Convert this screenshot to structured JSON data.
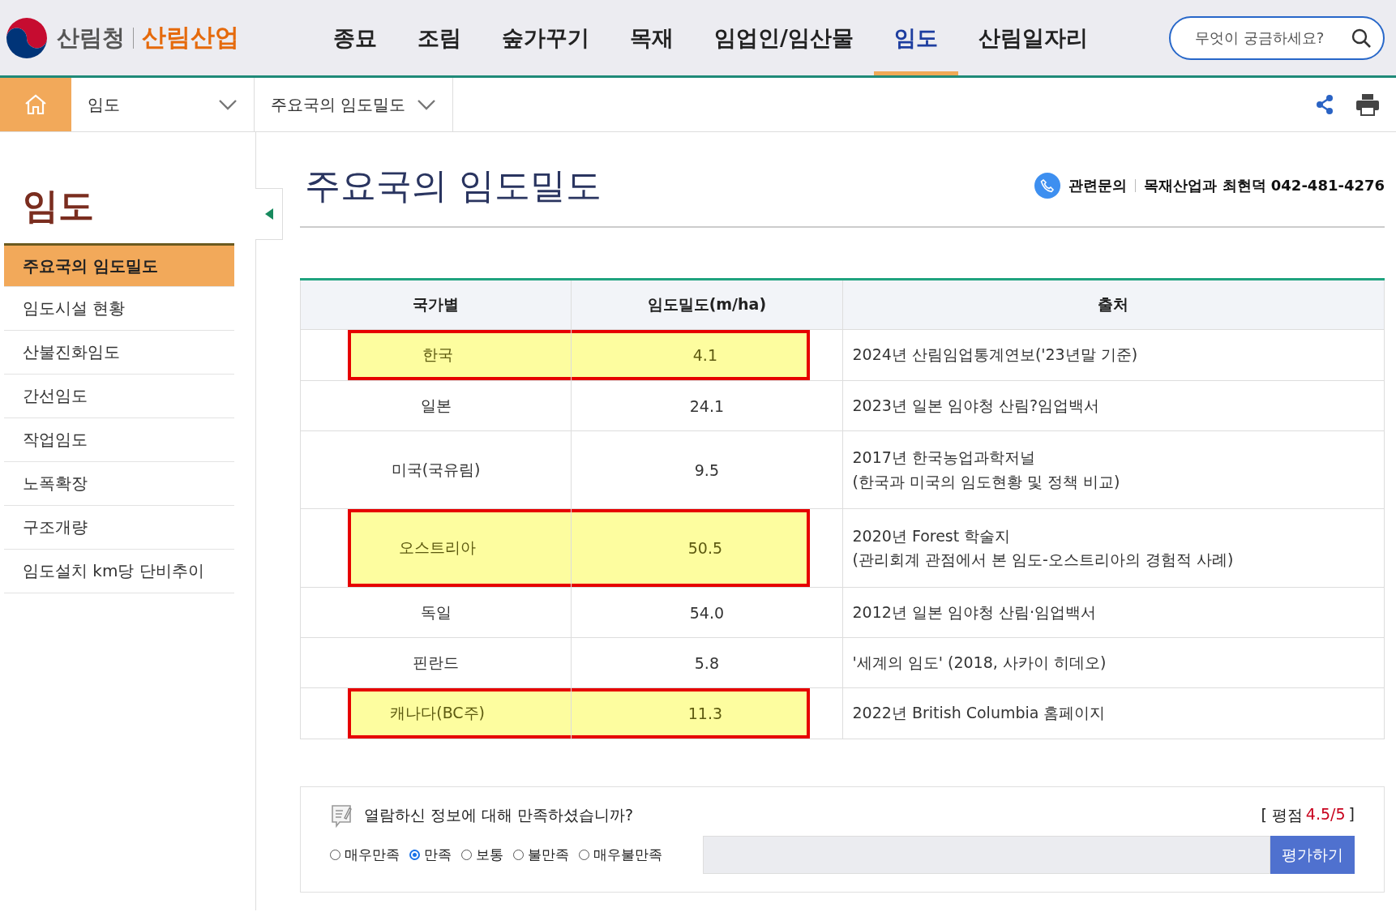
{
  "header": {
    "agency": "산림청",
    "site": "산림산업",
    "nav": [
      {
        "label": "종묘",
        "selected": false
      },
      {
        "label": "조림",
        "selected": false
      },
      {
        "label": "숲가꾸기",
        "selected": false
      },
      {
        "label": "목재",
        "selected": false
      },
      {
        "label": "임업인/임산물",
        "selected": false
      },
      {
        "label": "임도",
        "selected": true
      },
      {
        "label": "산림일자리",
        "selected": false
      }
    ],
    "search": {
      "placeholder": "무엇이 궁금하세요?"
    }
  },
  "breadcrumb": [
    {
      "label": "임도"
    },
    {
      "label": "주요국의 임도밀도"
    }
  ],
  "sidebar": {
    "title": "임도",
    "items": [
      {
        "label": "주요국의 임도밀도",
        "selected": true
      },
      {
        "label": "임도시설 현황",
        "selected": false
      },
      {
        "label": "산불진화임도",
        "selected": false
      },
      {
        "label": "간선임도",
        "selected": false
      },
      {
        "label": "작업임도",
        "selected": false
      },
      {
        "label": "노폭확장",
        "selected": false
      },
      {
        "label": "구조개량",
        "selected": false
      },
      {
        "label": "임도설치 km당 단비추이",
        "selected": false
      }
    ]
  },
  "page": {
    "title": "주요국의 임도밀도",
    "contact_label": "관련문의",
    "contact": "목재산업과 최현덕 042-481-4276"
  },
  "table": {
    "columns": [
      "국가별",
      "임도밀도(m/ha)",
      "출처"
    ],
    "rows": [
      {
        "country": "한국",
        "density": "4.1",
        "source": [
          "2024년 산림임업통계연보('23년말 기준)"
        ],
        "highlighted": true
      },
      {
        "country": "일본",
        "density": "24.1",
        "source": [
          "2023년 일본 임야청 산림?임업백서"
        ],
        "highlighted": false
      },
      {
        "country": "미국(국유림)",
        "density": "9.5",
        "source": [
          "2017년 한국농업과학저널",
          "(한국과 미국의 임도현황 및 정책 비교)"
        ],
        "highlighted": false
      },
      {
        "country": "오스트리아",
        "density": "50.5",
        "source": [
          "2020년 Forest 학술지",
          "(관리회계 관점에서 본 임도-오스트리아의 경험적 사례)"
        ],
        "highlighted": true
      },
      {
        "country": "독일",
        "density": "54.0",
        "source": [
          "2012년 일본 임야청 산림·임업백서"
        ],
        "highlighted": false
      },
      {
        "country": "핀란드",
        "density": "5.8",
        "source": [
          "'세계의 임도' (2018, 사카이 히데오)"
        ],
        "highlighted": false
      },
      {
        "country": "캐나다(BC주)",
        "density": "11.3",
        "source": [
          "2022년 British Columbia 홈페이지"
        ],
        "highlighted": true
      }
    ]
  },
  "feedback": {
    "question": "열람하신 정보에 대해 만족하셨습니까?",
    "rating_open": "[ 평점",
    "rating_value": "4.5/5",
    "rating_close": "]",
    "options": [
      {
        "label": "매우만족",
        "selected": false
      },
      {
        "label": "만족",
        "selected": true
      },
      {
        "label": "보통",
        "selected": false
      },
      {
        "label": "불만족",
        "selected": false
      },
      {
        "label": "매우불만족",
        "selected": false
      }
    ],
    "button": "평가하기"
  }
}
